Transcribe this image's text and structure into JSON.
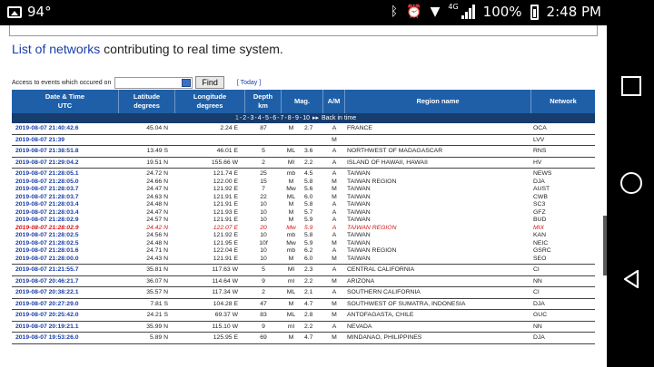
{
  "status_bar": {
    "temperature": "94°",
    "net_type": "4G",
    "battery_pct": "100%",
    "time": "2:48 PM",
    "icons": [
      "image-icon",
      "bluetooth-icon",
      "alarm-icon",
      "wifi-icon",
      "signal-icon",
      "battery-icon"
    ]
  },
  "nav_bar": {
    "icons": [
      "recent-apps-icon",
      "home-icon",
      "back-icon"
    ]
  },
  "page": {
    "networks_link": "List of networks",
    "networks_text": " contributing to real time system.",
    "access_label": "Access to events which occured on",
    "access_value": "",
    "find_button": "Find",
    "today_link": "[ Today ]"
  },
  "table": {
    "headers": {
      "datetime": "Date & Time",
      "datetime_sub": "UTC",
      "latitude": "Latitude",
      "latitude_sub": "degrees",
      "longitude": "Longitude",
      "longitude_sub": "degrees",
      "depth": "Depth",
      "depth_sub": "km",
      "mag": "Mag.",
      "am": "A/M",
      "region": "Region name",
      "network": "Network"
    },
    "pager": {
      "pages": [
        "1",
        "2",
        "3",
        "4",
        "5",
        "6",
        "7",
        "8",
        "9",
        "10"
      ],
      "current": "1",
      "next_label": "Back in time"
    },
    "groups": [
      [
        {
          "dt": "2019-08-07 21:40:42.6",
          "lat": "45.04 N",
          "lon": "2.24 E",
          "dep": "87",
          "typ": "M",
          "mag": "2.7",
          "am": "A",
          "reg": "FRANCE",
          "net": "OCA"
        }
      ],
      [
        {
          "dt": "2019-08-07 21:39",
          "lat": "",
          "lon": "",
          "dep": "",
          "typ": "",
          "mag": "",
          "am": "M",
          "reg": "",
          "net": "LVV"
        }
      ],
      [
        {
          "dt": "2019-08-07 21:38:51.8",
          "lat": "13.49 S",
          "lon": "46.01 E",
          "dep": "5",
          "typ": "ML",
          "mag": "3.6",
          "am": "A",
          "reg": "NORTHWEST OF MADAGASCAR",
          "net": "RNS"
        }
      ],
      [
        {
          "dt": "2019-08-07 21:29:04.2",
          "lat": "19.51 N",
          "lon": "155.66 W",
          "dep": "2",
          "typ": "Ml",
          "mag": "2.2",
          "am": "A",
          "reg": "ISLAND OF HAWAII, HAWAII",
          "net": "HV"
        }
      ],
      [
        {
          "dt": "2019-08-07 21:28:05.1",
          "lat": "24.72 N",
          "lon": "121.74 E",
          "dep": "25",
          "typ": "mb",
          "mag": "4.5",
          "am": "A",
          "reg": "TAIWAN",
          "net": "NEWS"
        },
        {
          "dt": "2019-08-07 21:28:05.0",
          "lat": "24.66 N",
          "lon": "122.00 E",
          "dep": "15",
          "typ": "M",
          "mag": "5.8",
          "am": "M",
          "reg": "TAIWAN REGION",
          "net": "DJA"
        },
        {
          "dt": "2019-08-07 21:28:03.7",
          "lat": "24.47 N",
          "lon": "121.92 E",
          "dep": "7",
          "typ": "Mw",
          "mag": "5.6",
          "am": "M",
          "reg": "TAIWAN",
          "net": "AUST"
        },
        {
          "dt": "2019-08-07 21:28:03.7",
          "lat": "24.63 N",
          "lon": "121.91 E",
          "dep": "22",
          "typ": "ML",
          "mag": "6.0",
          "am": "M",
          "reg": "TAIWAN",
          "net": "CWB"
        },
        {
          "dt": "2019-08-07 21:28:03.4",
          "lat": "24.48 N",
          "lon": "121.91 E",
          "dep": "10",
          "typ": "M",
          "mag": "5.8",
          "am": "A",
          "reg": "TAIWAN",
          "net": "SC3"
        },
        {
          "dt": "2019-08-07 21:28:03.4",
          "lat": "24.47 N",
          "lon": "121.93 E",
          "dep": "10",
          "typ": "M",
          "mag": "5.7",
          "am": "A",
          "reg": "TAIWAN",
          "net": "GFZ"
        },
        {
          "dt": "2019-08-07 21:28:02.9",
          "lat": "24.57 N",
          "lon": "121.91 E",
          "dep": "10",
          "typ": "M",
          "mag": "5.9",
          "am": "A",
          "reg": "TAIWAN",
          "net": "BUD"
        },
        {
          "dt": "2019-08-07 21:28:02.9",
          "lat": "24.42 N",
          "lon": "122.07 E",
          "dep": "20",
          "typ": "Mw",
          "mag": "5.9",
          "am": "A",
          "reg": "TAIWAN REGION",
          "net": "MIX",
          "highlight": true
        },
        {
          "dt": "2019-08-07 21:28:02.5",
          "lat": "24.56 N",
          "lon": "121.92 E",
          "dep": "10",
          "typ": "mb",
          "mag": "5.8",
          "am": "A",
          "reg": "TAIWAN",
          "net": "KAN"
        },
        {
          "dt": "2019-08-07 21:28:02.5",
          "lat": "24.48 N",
          "lon": "121.95 E",
          "dep": "10f",
          "typ": "Mw",
          "mag": "5.9",
          "am": "M",
          "reg": "TAIWAN",
          "net": "NEIC"
        },
        {
          "dt": "2019-08-07 21:28:01.6",
          "lat": "24.71 N",
          "lon": "122.04 E",
          "dep": "10",
          "typ": "mb",
          "mag": "6.2",
          "am": "A",
          "reg": "TAIWAN REGION",
          "net": "GSRC"
        },
        {
          "dt": "2019-08-07 21:28:00.0",
          "lat": "24.43 N",
          "lon": "121.91 E",
          "dep": "10",
          "typ": "M",
          "mag": "6.0",
          "am": "M",
          "reg": "TAIWAN",
          "net": "SEO"
        }
      ],
      [
        {
          "dt": "2019-08-07 21:21:55.7",
          "lat": "35.81 N",
          "lon": "117.63 W",
          "dep": "5",
          "typ": "Ml",
          "mag": "2.3",
          "am": "A",
          "reg": "CENTRAL CALIFORNIA",
          "net": "CI"
        }
      ],
      [
        {
          "dt": "2019-08-07 20:46:21.7",
          "lat": "36.07 N",
          "lon": "114.64 W",
          "dep": "9",
          "typ": "ml",
          "mag": "2.2",
          "am": "M",
          "reg": "ARIZONA",
          "net": "NN"
        }
      ],
      [
        {
          "dt": "2019-08-07 20:38:22.1",
          "lat": "35.57 N",
          "lon": "117.34 W",
          "dep": "2",
          "typ": "ML",
          "mag": "2.1",
          "am": "A",
          "reg": "SOUTHERN CALIFORNIA",
          "net": "CI"
        }
      ],
      [
        {
          "dt": "2019-08-07 20:27:29.0",
          "lat": "7.81 S",
          "lon": "104.28 E",
          "dep": "47",
          "typ": "M",
          "mag": "4.7",
          "am": "M",
          "reg": "SOUTHWEST OF SUMATRA, INDONESIA",
          "net": "DJA"
        }
      ],
      [
        {
          "dt": "2019-08-07 20:25:42.0",
          "lat": "24.21 S",
          "lon": "69.37 W",
          "dep": "83",
          "typ": "ML",
          "mag": "2.8",
          "am": "M",
          "reg": "ANTOFAGASTA, CHILE",
          "net": "GUC"
        }
      ],
      [
        {
          "dt": "2019-08-07 20:19:21.1",
          "lat": "35.99 N",
          "lon": "115.10 W",
          "dep": "9",
          "typ": "ml",
          "mag": "2.2",
          "am": "A",
          "reg": "NEVADA",
          "net": "NN"
        }
      ],
      [
        {
          "dt": "2019-08-07 19:53:26.0",
          "lat": "5.89 N",
          "lon": "125.95 E",
          "dep": "69",
          "typ": "M",
          "mag": "4.7",
          "am": "M",
          "reg": "MINDANAO, PHILIPPINES",
          "net": "DJA"
        }
      ]
    ]
  }
}
